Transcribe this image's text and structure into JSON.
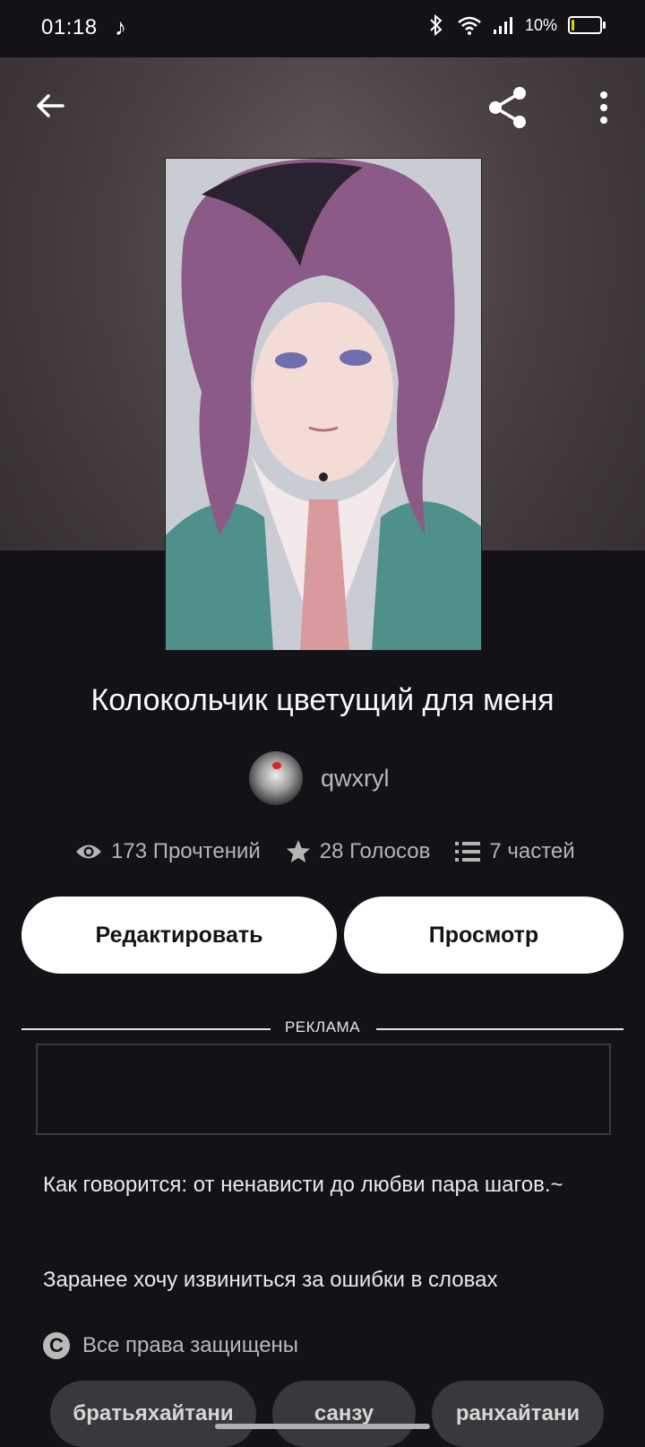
{
  "status_bar": {
    "time": "01:18",
    "battery": "10%",
    "battery_level": 0.1
  },
  "story": {
    "title": "Колокольчик цветущий для меня",
    "author": "qwxryl"
  },
  "stats": {
    "reads": "173 Прочтений",
    "votes": "28 Голосов",
    "parts": "7 частей"
  },
  "buttons": {
    "edit": "Редактировать",
    "view": "Просмотр"
  },
  "ad": {
    "label": "РЕКЛАМА"
  },
  "description": {
    "line1": "Как говорится: от ненависти до любви пара шагов.~",
    "line2": "Заранее хочу извиниться за ошибки в словах"
  },
  "copyright": {
    "text": "Все права защищены"
  },
  "tags": [
    "братьяхайтани",
    "санзу",
    "ранхайтани"
  ],
  "icons": [
    "back-arrow-icon",
    "share-icon",
    "more-vertical-icon",
    "eye-icon",
    "star-icon",
    "list-icon",
    "copyright-icon",
    "music-note-icon",
    "bluetooth-icon",
    "wifi-icon",
    "signal-icon",
    "battery-icon"
  ],
  "colors": {
    "background": "#141216",
    "button": "#ffffff",
    "tag": "#3a383c",
    "battery_fill": "#e6d200"
  }
}
